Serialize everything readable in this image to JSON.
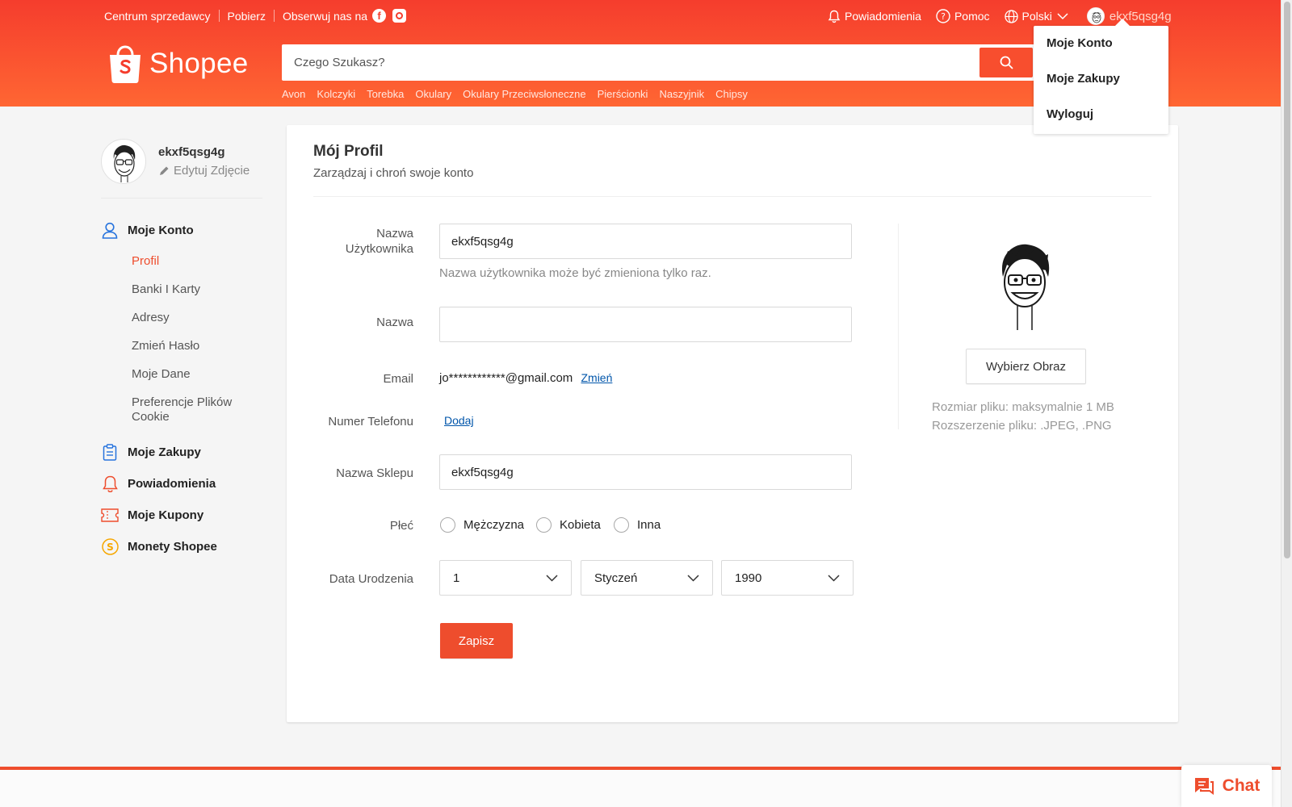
{
  "topbar": {
    "seller_centre": "Centrum sprzedawcy",
    "download": "Pobierz",
    "follow": "Obserwuj nas na",
    "notifications": "Powiadomienia",
    "help": "Pomoc",
    "language": "Polski",
    "username": "ekxf5qsg4g"
  },
  "logo": {
    "text": "Shopee"
  },
  "search": {
    "placeholder": "Czego Szukasz?",
    "suggestions": [
      "Avon",
      "Kolczyki",
      "Torebka",
      "Okulary",
      "Okulary Przeciwsłoneczne",
      "Pierścionki",
      "Naszyjnik",
      "Chipsy"
    ]
  },
  "dropdown": {
    "items": [
      "Moje Konto",
      "Moje Zakupy",
      "Wyloguj"
    ]
  },
  "sidebar": {
    "username": "ekxf5qsg4g",
    "edit_photo": "Edytuj Zdjęcie",
    "my_account": "Moje Konto",
    "sub_items": [
      "Profil",
      "Banki I Karty",
      "Adresy",
      "Zmień Hasło",
      "Moje Dane",
      "Preferencje Plików Cookie"
    ],
    "my_purchases": "Moje Zakupy",
    "notifications": "Powiadomienia",
    "coupons": "Moje Kupony",
    "coins": "Monety Shopee"
  },
  "profile": {
    "title": "Mój Profil",
    "subtitle": "Zarządzaj i chroń swoje konto",
    "username_label": "Nazwa Użytkownika",
    "username_value": "ekxf5qsg4g",
    "username_hint": "Nazwa użytkownika może być zmieniona tylko raz.",
    "name_label": "Nazwa",
    "name_value": "",
    "email_label": "Email",
    "email_value": "jo************@gmail.com",
    "email_change": "Zmień",
    "phone_label": "Numer Telefonu",
    "phone_add": "Dodaj",
    "shop_label": "Nazwa Sklepu",
    "shop_value": "ekxf5qsg4g",
    "gender_label": "Płeć",
    "gender_options": [
      "Mężczyzna",
      "Kobieta",
      "Inna"
    ],
    "dob_label": "Data Urodzenia",
    "dob_day": "1",
    "dob_month": "Styczeń",
    "dob_year": "1990",
    "save": "Zapisz",
    "choose_image": "Wybierz Obraz",
    "file_size": "Rozmiar pliku: maksymalnie 1 MB",
    "file_ext": "Rozszerzenie pliku: .JPEG, .PNG"
  },
  "chat": {
    "label": "Chat"
  },
  "colors": {
    "brand": "#ee4d2d",
    "link": "#0055aa"
  }
}
